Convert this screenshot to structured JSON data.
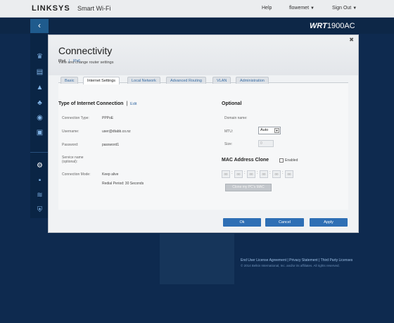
{
  "header": {
    "brand": "LINKSYS",
    "brand_sub": "Smart Wi-Fi",
    "help": "Help",
    "user": "flowemet",
    "sign_out": "Sign Out",
    "model": "WRT",
    "model_num": "1900AC"
  },
  "sidebar": {
    "icons": [
      "network-map-icon",
      "devices-icon",
      "alert-icon",
      "parental-controls-icon",
      "media-prioritization-icon",
      "speed-test-icon",
      "connectivity-icon",
      "external-storage-icon",
      "wireless-icon",
      "security-icon"
    ],
    "active": "connectivity-icon"
  },
  "modal": {
    "title": "Connectivity",
    "subtitle": "View and change router settings",
    "close": "✖",
    "tabs": [
      "Basic",
      "Internet Settings",
      "Local Network",
      "Advanced Routing",
      "VLAN",
      "Administration"
    ],
    "active_tab": "Internet Settings",
    "subtabs": [
      "IPv4",
      "IPv6"
    ],
    "left": {
      "heading": "Type of Internet Connection",
      "separator": "|",
      "edit": "Edit",
      "rows": [
        {
          "label": "Connection Type:",
          "value": "PPPoE"
        },
        {
          "label": "Username:",
          "value": "user@dtabb.co.nz"
        },
        {
          "label": "Password:",
          "value": "password1"
        },
        {
          "label": "Service name",
          "label2": "(optional):",
          "value": ""
        },
        {
          "label": "Connection Mode:",
          "value": "Keep alive",
          "value2": "Redial Period: 30 Seconds"
        }
      ]
    },
    "right": {
      "heading": "Optional",
      "domain_label": "Domain name:",
      "mtu_label": "MTU:",
      "mtu_value": "Auto",
      "size_label": "Size:",
      "size_value": "0",
      "mac_heading": "MAC Address Clone",
      "enabled_label": "Enabled",
      "mac_fields": [
        "00",
        "00",
        "00",
        "00",
        "00",
        "00"
      ],
      "mac_separator": ":",
      "clone_button": "Clone my PC's MAC"
    },
    "buttons": {
      "ok": "Ok",
      "cancel": "Cancel",
      "apply": "Apply"
    }
  },
  "footer": {
    "links": "End User License Agreement  |  Privacy Statement  |  Third Party Licenses",
    "copyright": "© 2014 Belkin International, Inc. and/or its affiliates. All rights reserved."
  },
  "colors": {
    "accent": "#2e6fb5",
    "background": "#0e2a4f"
  }
}
